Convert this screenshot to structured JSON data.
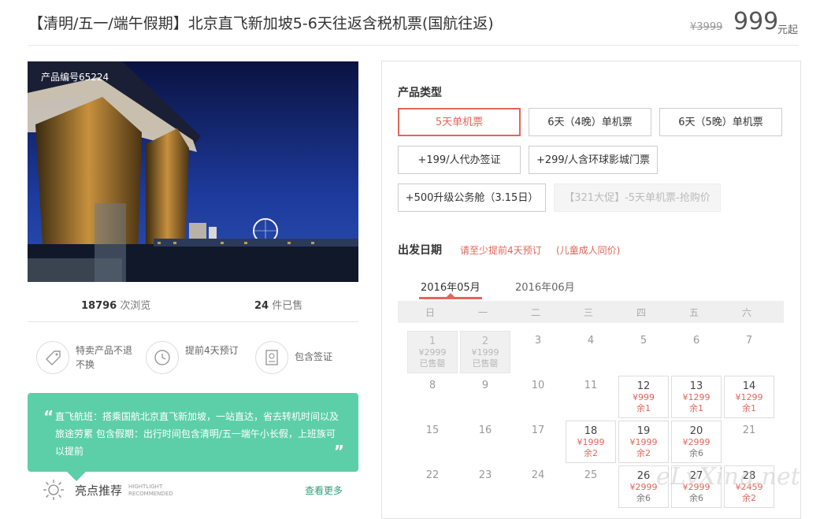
{
  "header": {
    "title": "【清明/五一/端午假期】北京直飞新加坡5-6天往返含税机票(国航往返)",
    "original_price": "¥3999",
    "price": "999",
    "price_unit": "元起"
  },
  "gallery": {
    "product_code": "产品编号65224"
  },
  "stats": {
    "views_value": "18796",
    "views_label": "次浏览",
    "sold_value": "24",
    "sold_label": "件已售"
  },
  "features": [
    {
      "icon": "tag-icon",
      "label": "特卖产品不退不换"
    },
    {
      "icon": "clock-icon",
      "label": "提前4天预订"
    },
    {
      "icon": "passport-icon",
      "label": "包含签证"
    }
  ],
  "highlight": {
    "text": "直飞航班：搭乘国航北京直飞新加坡，一站直达，省去转机时间以及旅途劳累 包含假期：出行时间包含清明/五一端午小长假，上班族可以提前",
    "title": "亮点推荐",
    "title_en_1": "HIGHTLIGHT",
    "title_en_2": "RECOMMENDED",
    "more": "查看更多"
  },
  "product_type": {
    "label": "产品类型",
    "options": [
      {
        "label": "5天单机票",
        "state": "selected"
      },
      {
        "label": "6天（4晚）单机票",
        "state": "normal"
      },
      {
        "label": "6天（5晚）单机票",
        "state": "normal"
      },
      {
        "label": "+199/人代办签证",
        "state": "normal"
      },
      {
        "label": "+299/人含环球影城门票",
        "state": "normal"
      },
      {
        "label": "+500升级公务舱（3.15日）",
        "state": "normal"
      },
      {
        "label": "【321大促】-5天单机票-抢购价",
        "state": "disabled"
      }
    ]
  },
  "departure": {
    "label": "出发日期",
    "note1": "请至少提前4天预订",
    "note2": "(儿童成人同价)",
    "months": [
      "2016年05月",
      "2016年06月"
    ],
    "weekdays": [
      "日",
      "一",
      "二",
      "三",
      "四",
      "五",
      "六"
    ],
    "weeks": [
      [
        {
          "day": "1",
          "price": "¥2999",
          "stock": "已售罄",
          "state": "soldout"
        },
        {
          "day": "2",
          "price": "¥1999",
          "stock": "已售罄",
          "state": "soldout"
        },
        {
          "day": "3"
        },
        {
          "day": "4"
        },
        {
          "day": "5"
        },
        {
          "day": "6"
        },
        {
          "day": "7"
        }
      ],
      [
        {
          "day": "8"
        },
        {
          "day": "9"
        },
        {
          "day": "10"
        },
        {
          "day": "11"
        },
        {
          "day": "12",
          "price": "¥999",
          "stock": "余1",
          "state": "available"
        },
        {
          "day": "13",
          "price": "¥1299",
          "stock": "余1",
          "state": "available"
        },
        {
          "day": "14",
          "price": "¥1299",
          "stock": "余1",
          "state": "available"
        }
      ],
      [
        {
          "day": "15"
        },
        {
          "day": "16"
        },
        {
          "day": "17"
        },
        {
          "day": "18",
          "price": "¥1999",
          "stock": "余2",
          "state": "available"
        },
        {
          "day": "19",
          "price": "¥1999",
          "stock": "余2",
          "state": "available"
        },
        {
          "day": "20",
          "price": "¥2999",
          "stock": "余6",
          "state": "available"
        },
        {
          "day": "21"
        }
      ],
      [
        {
          "day": "22"
        },
        {
          "day": "23"
        },
        {
          "day": "24"
        },
        {
          "day": "25"
        },
        {
          "day": "26",
          "price": "¥2999",
          "stock": "余6",
          "state": "available"
        },
        {
          "day": "27",
          "price": "¥2999",
          "stock": "余6",
          "state": "available"
        },
        {
          "day": "28",
          "price": "¥2459",
          "stock": "余2",
          "state": "available"
        }
      ]
    ]
  },
  "watermark": "eLvXing.net",
  "colors": {
    "accent": "#e4655b",
    "green": "#5dcfa8"
  }
}
